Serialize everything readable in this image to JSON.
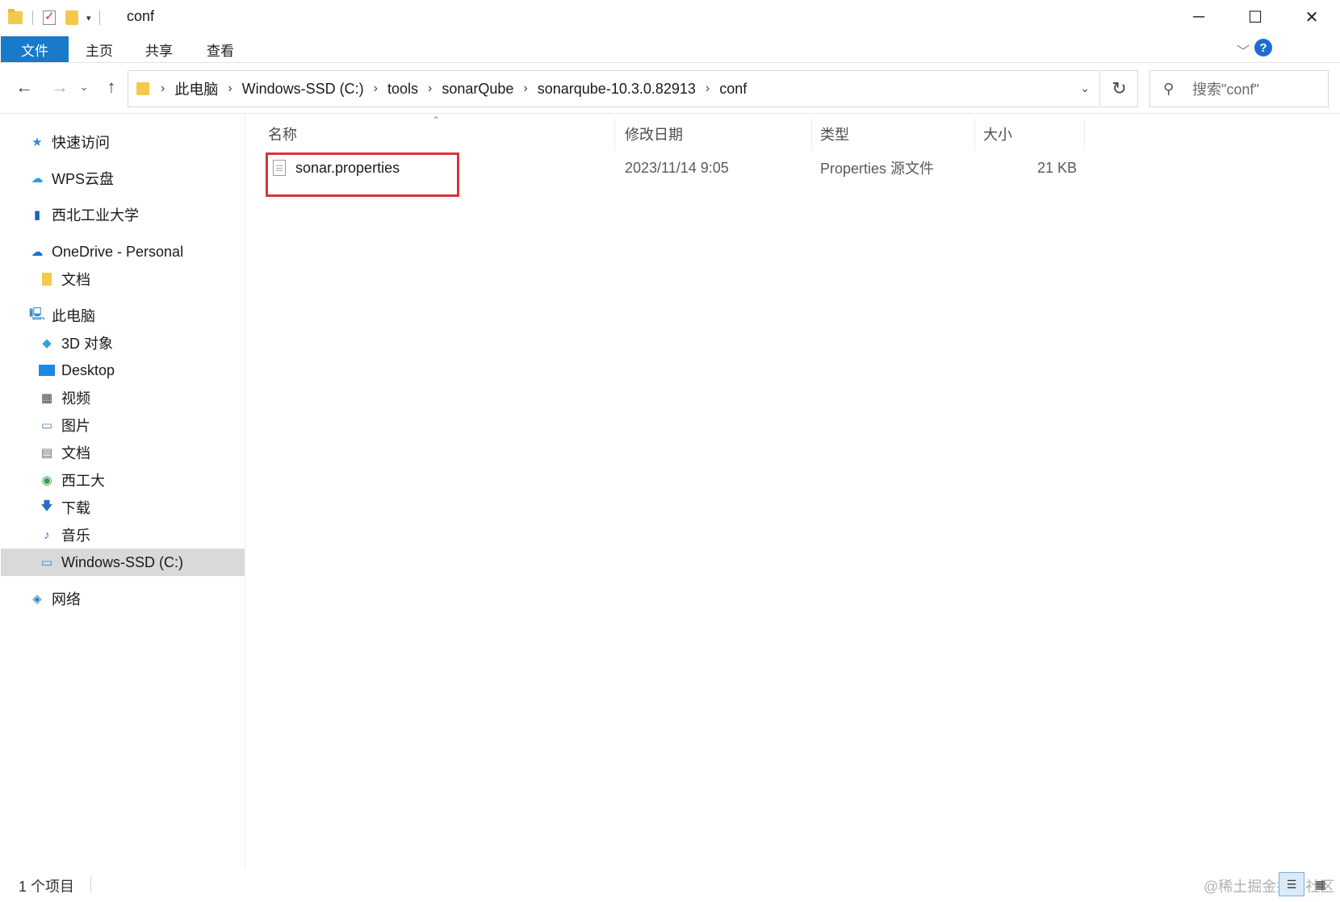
{
  "window": {
    "title": "conf",
    "minimize_glyph": "─",
    "maximize_glyph": "☐",
    "close_glyph": "✕"
  },
  "ribbon": {
    "tabs": [
      {
        "label": "文件"
      },
      {
        "label": "主页"
      },
      {
        "label": "共享"
      },
      {
        "label": "查看"
      }
    ],
    "help_label": "?"
  },
  "address": {
    "crumbs": [
      "此电脑",
      "Windows-SSD (C:)",
      "tools",
      "sonarQube",
      "sonarqube-10.3.0.82913",
      "conf"
    ],
    "search_placeholder": "搜索\"conf\""
  },
  "sidebar": {
    "items": [
      {
        "label": "快速访问",
        "icon": "star-icon"
      },
      {
        "label": "WPS云盘",
        "icon": "cloud-icon"
      },
      {
        "label": "西北工业大学",
        "icon": "building-icon"
      },
      {
        "label": "OneDrive - Personal",
        "icon": "onedrive-icon"
      },
      {
        "label": "文档",
        "icon": "folder-icon"
      },
      {
        "label": "此电脑",
        "icon": "computer-icon"
      },
      {
        "label": "3D 对象",
        "icon": "cube-icon"
      },
      {
        "label": "Desktop",
        "icon": "desktop-icon"
      },
      {
        "label": "视频",
        "icon": "film-icon"
      },
      {
        "label": "图片",
        "icon": "picture-icon"
      },
      {
        "label": "文档",
        "icon": "document-icon"
      },
      {
        "label": "西工大",
        "icon": "network-folder-icon"
      },
      {
        "label": "下载",
        "icon": "download-icon"
      },
      {
        "label": "音乐",
        "icon": "music-icon"
      },
      {
        "label": "Windows-SSD (C:)",
        "icon": "drive-icon",
        "selected": true
      },
      {
        "label": "网络",
        "icon": "network-icon"
      }
    ]
  },
  "columns": [
    {
      "label": "名称"
    },
    {
      "label": "修改日期"
    },
    {
      "label": "类型"
    },
    {
      "label": "大小"
    }
  ],
  "files": [
    {
      "name": "sonar.properties",
      "modified": "2023/11/14 9:05",
      "type": "Properties 源文件",
      "size": "21 KB"
    }
  ],
  "status": {
    "item_count": "1 个项目",
    "watermark": "@稀土掘金技术社区"
  },
  "colors": {
    "accent": "#1979ca",
    "highlight_box": "#d6353b",
    "selected_bg": "#d9d9d9"
  }
}
